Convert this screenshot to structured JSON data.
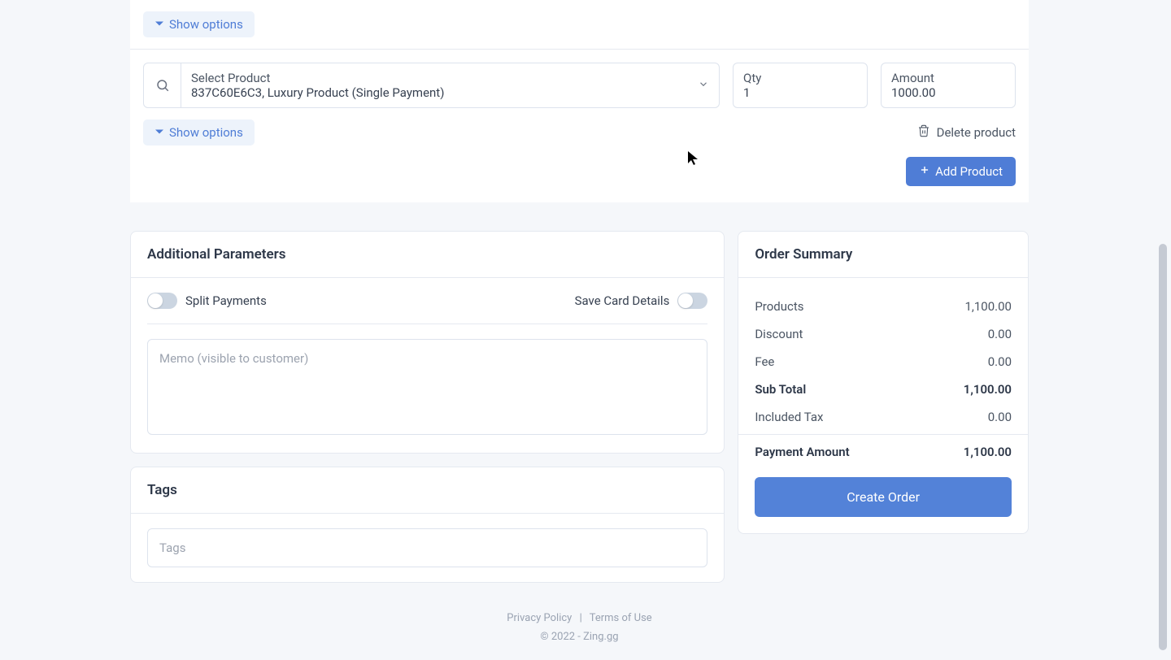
{
  "product": {
    "show_options_label": "Show options",
    "select_label": "Select Product",
    "select_value": "837C60E6C3, Luxury Product (Single Payment)",
    "qty_label": "Qty",
    "qty_value": "1",
    "amount_label": "Amount",
    "amount_value": "1000.00",
    "delete_label": "Delete product",
    "add_label": "Add Product"
  },
  "additional": {
    "title": "Additional Parameters",
    "split_label": "Split Payments",
    "save_card_label": "Save Card Details",
    "memo_placeholder": "Memo (visible to customer)"
  },
  "tags": {
    "title": "Tags",
    "placeholder": "Tags"
  },
  "summary": {
    "title": "Order Summary",
    "lines": {
      "products_label": "Products",
      "products_value": "1,100.00",
      "discount_label": "Discount",
      "discount_value": "0.00",
      "fee_label": "Fee",
      "fee_value": "0.00",
      "subtotal_label": "Sub Total",
      "subtotal_value": "1,100.00",
      "tax_label": "Included Tax",
      "tax_value": "0.00",
      "payment_label": "Payment Amount",
      "payment_value": "1,100.00"
    },
    "create_label": "Create Order"
  },
  "footer": {
    "privacy": "Privacy Policy",
    "terms": "Terms of Use",
    "copyright": "© 2022 - Zing.gg"
  }
}
